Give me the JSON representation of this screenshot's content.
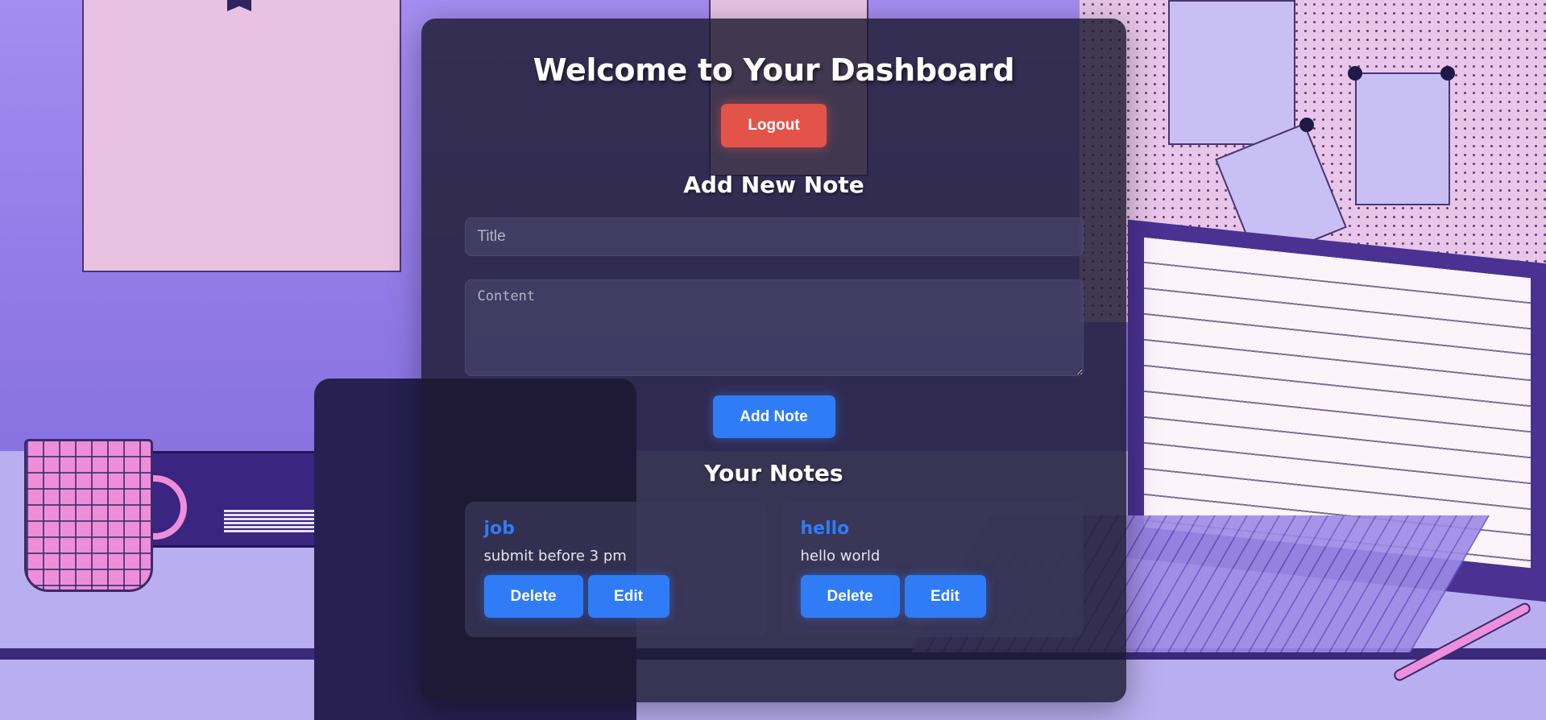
{
  "page": {
    "title": "Welcome to Your Dashboard",
    "logout_label": "Logout"
  },
  "add_note": {
    "heading": "Add New Note",
    "title_placeholder": "Title",
    "content_placeholder": "Content",
    "submit_label": "Add Note"
  },
  "notes_section": {
    "heading": "Your Notes",
    "notes": [
      {
        "title": "job",
        "content": "submit before 3 pm",
        "delete_label": "Delete",
        "edit_label": "Edit"
      },
      {
        "title": "hello",
        "content": "hello world",
        "delete_label": "Delete",
        "edit_label": "Edit"
      }
    ]
  },
  "colors": {
    "primary_button": "#2f7cf6",
    "logout_button": "#e4534a",
    "panel_background": "#1c1a30",
    "note_title": "#2f7cf6"
  },
  "background": {
    "description_icon": "illustrated-desk-background"
  }
}
